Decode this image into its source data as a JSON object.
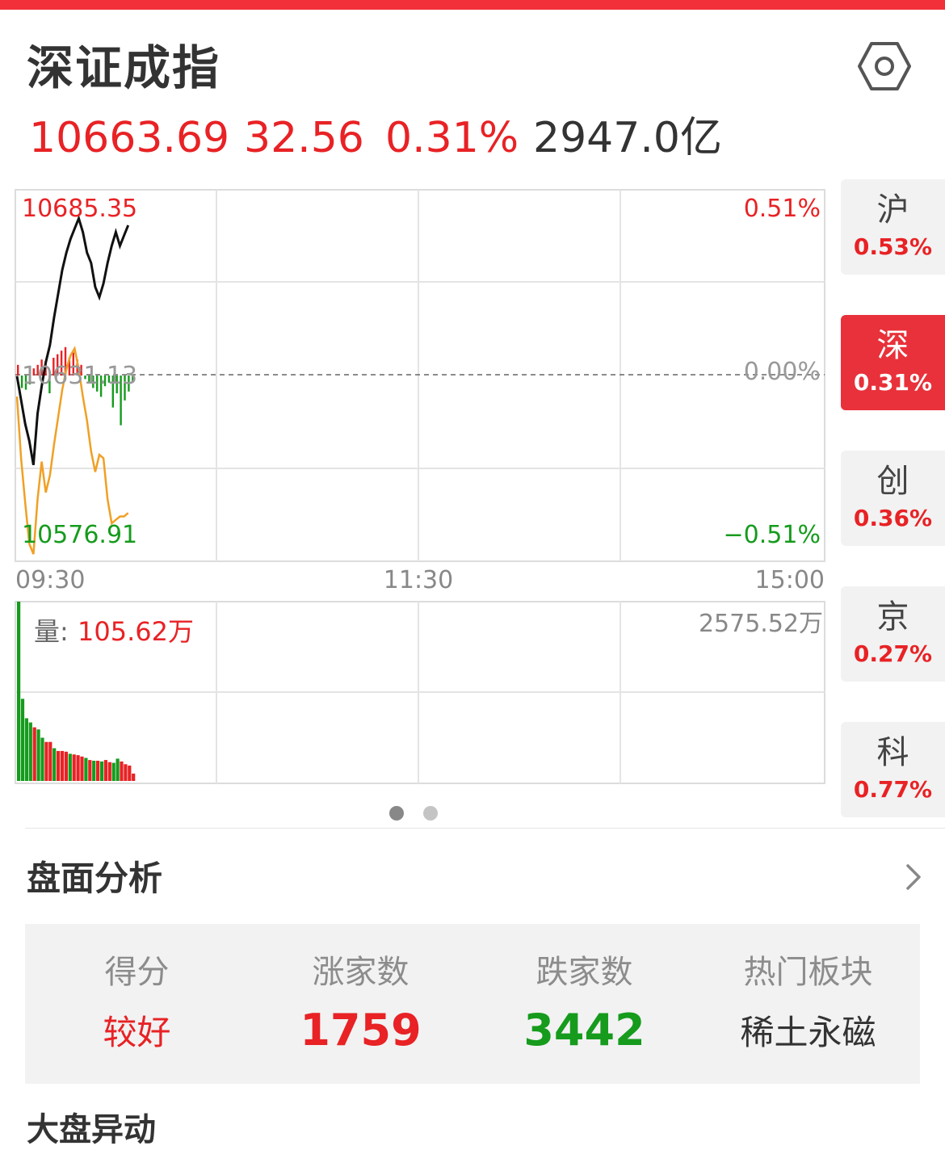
{
  "header": {
    "title": "深证成指",
    "settings_icon": "hexagon-settings-icon"
  },
  "quote": {
    "price": "10663.69",
    "change": "32.56",
    "change_pct": "0.31%",
    "amount": "2947.0亿"
  },
  "intraday": {
    "upper_price": "10685.35",
    "lower_price": "10576.91",
    "prev_close": "10631.13",
    "upper_pct": "0.51%",
    "zero_pct": "0.00%",
    "lower_pct": "−0.51%",
    "time_start": "09:30",
    "time_mid": "11:30",
    "time_end": "15:00",
    "volume_label": "量:",
    "volume_value": "105.62万",
    "volume_max": "2575.52万"
  },
  "chart_data": {
    "type": "line",
    "xlabel": "",
    "ylabel": "",
    "x_range": [
      "09:30",
      "15:00"
    ],
    "ylim": [
      10576.91,
      10685.35
    ],
    "prev_close": 10631.13,
    "series": [
      {
        "values": [
          10631,
          10624,
          10617,
          10612,
          10605,
          10620,
          10628,
          10635,
          10640,
          10648,
          10655,
          10662,
          10667,
          10671,
          10674,
          10677,
          10673,
          10667,
          10664,
          10657,
          10654,
          10658,
          10664,
          10669,
          10673,
          10669,
          10672,
          10675
        ]
      },
      {
        "values": [
          10625,
          10607,
          10594,
          10582,
          10579,
          10595,
          10606,
          10597,
          10602,
          10611,
          10619,
          10627,
          10633,
          10637,
          10639,
          10633,
          10625,
          10618,
          10609,
          10603,
          10608,
          10607,
          10595,
          10588,
          10589,
          10590,
          10590,
          10591
        ]
      }
    ],
    "volume": {
      "max_label": "2575.52万",
      "values": [
        2575,
        1180,
        900,
        840,
        770,
        740,
        620,
        560,
        560,
        470,
        430,
        430,
        420,
        390,
        380,
        370,
        350,
        330,
        300,
        290,
        290,
        280,
        300,
        270,
        260,
        320,
        280,
        240,
        220,
        105
      ],
      "colors": [
        "green",
        "green",
        "green",
        "green",
        "red",
        "green",
        "green",
        "red",
        "red",
        "green",
        "red",
        "red",
        "red",
        "green",
        "red",
        "red",
        "red",
        "green",
        "red",
        "green",
        "red",
        "green",
        "red",
        "red",
        "green",
        "green",
        "red",
        "red",
        "red",
        "red"
      ]
    },
    "diff_bars": [
      6,
      -7,
      -8,
      -5,
      4,
      6,
      9,
      8,
      -10,
      10,
      12,
      14,
      16,
      10,
      13,
      9,
      6,
      -2,
      -4,
      -7,
      -9,
      -12,
      -6,
      -4,
      -18,
      -10,
      -28,
      -14,
      -9,
      -4
    ]
  },
  "side_tabs": [
    {
      "label": "沪",
      "pct": "0.53%"
    },
    {
      "label": "深",
      "pct": "0.31%"
    },
    {
      "label": "创",
      "pct": "0.36%"
    },
    {
      "label": "京",
      "pct": "0.27%"
    },
    {
      "label": "科",
      "pct": "0.77%"
    }
  ],
  "analysis": {
    "title": "盘面分析",
    "chevron_icon": "chevron-right-icon",
    "stats": [
      {
        "label": "得分",
        "value": "较好"
      },
      {
        "label": "涨家数",
        "value": "1759"
      },
      {
        "label": "跌家数",
        "value": "3442"
      },
      {
        "label": "热门板块",
        "value": "稀土永磁"
      }
    ]
  },
  "next_section_title": "大盘异动",
  "colors": {
    "up": "#e82225",
    "down": "#169b1d",
    "accent": "#f2303a"
  }
}
